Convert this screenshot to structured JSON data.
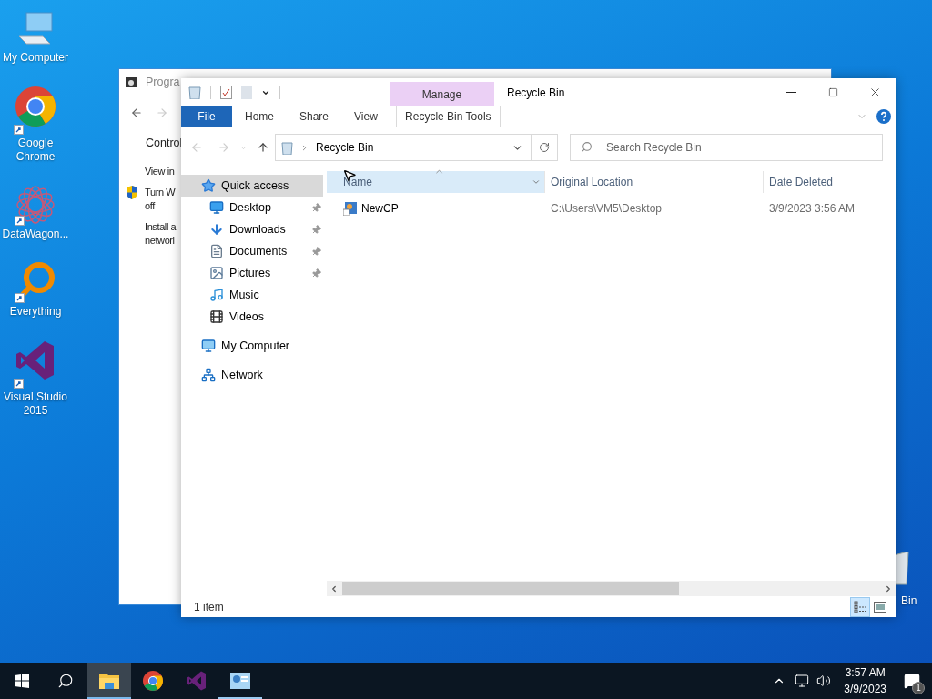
{
  "desktop_icons": [
    {
      "kind": "computer",
      "label": "My Computer",
      "shortcut": false
    },
    {
      "kind": "chrome",
      "label": "Google Chrome",
      "shortcut": true
    },
    {
      "kind": "datawagon",
      "label": "DataWagon...",
      "shortcut": true
    },
    {
      "kind": "everything",
      "label": "Everything",
      "shortcut": true
    },
    {
      "kind": "vs",
      "label": "Visual Studio 2015",
      "shortcut": true
    }
  ],
  "recycle_icon": {
    "label": "Bin"
  },
  "background_window": {
    "title": "Progra",
    "link": "Control",
    "lines": [
      {
        "text": "View in",
        "shield": false
      },
      {
        "text": "Turn W\noff",
        "shield": true
      },
      {
        "text": "Install a\nnetworl",
        "shield": false
      }
    ]
  },
  "explorer": {
    "title": "Recycle Bin",
    "context_group": "Manage",
    "ribbon_tabs": [
      {
        "label": "File",
        "kind": "file"
      },
      {
        "label": "Home",
        "kind": "tab"
      },
      {
        "label": "Share",
        "kind": "tab"
      },
      {
        "label": "View",
        "kind": "tab"
      },
      {
        "label": "Recycle Bin Tools",
        "kind": "context"
      }
    ],
    "address": "Recycle Bin",
    "search": {
      "placeholder": "Search Recycle Bin"
    },
    "nav": [
      {
        "label": "Quick access",
        "kind": "star",
        "selected": true,
        "children": [
          {
            "label": "Desktop",
            "kind": "desktop",
            "pinned": true,
            "selected": false
          },
          {
            "label": "Downloads",
            "kind": "downloads",
            "pinned": true,
            "selected": false
          },
          {
            "label": "Documents",
            "kind": "documents",
            "pinned": true,
            "selected": false
          },
          {
            "label": "Pictures",
            "kind": "pictures",
            "pinned": true,
            "selected": false
          },
          {
            "label": "Music",
            "kind": "music",
            "pinned": false,
            "selected": false
          },
          {
            "label": "Videos",
            "kind": "videos",
            "pinned": false,
            "selected": false
          }
        ]
      },
      {
        "label": "My Computer",
        "kind": "computer",
        "selected": false
      },
      {
        "label": "Network",
        "kind": "network",
        "selected": false
      }
    ],
    "columns": [
      {
        "label": "Name",
        "sorted": true
      },
      {
        "label": "Original Location",
        "sorted": false
      },
      {
        "label": "Date Deleted",
        "sorted": false
      }
    ],
    "rows": [
      {
        "cells": [
          "NewCP",
          "C:\\Users\\VM5\\Desktop",
          "3/9/2023 3:56 AM"
        ],
        "selected": false
      }
    ],
    "status": "1 item",
    "views": [
      {
        "kind": "details",
        "selected": true
      },
      {
        "kind": "tiles",
        "selected": false
      }
    ]
  },
  "taskbar": {
    "apps": [
      {
        "kind": "explorer",
        "active": true,
        "running": false
      },
      {
        "kind": "chrome",
        "active": false,
        "running": false
      },
      {
        "kind": "vs",
        "active": false,
        "running": false
      },
      {
        "kind": "app",
        "active": false,
        "running": true
      }
    ],
    "time": "3:57 AM",
    "date": "3/9/2023",
    "notifications": "1"
  }
}
